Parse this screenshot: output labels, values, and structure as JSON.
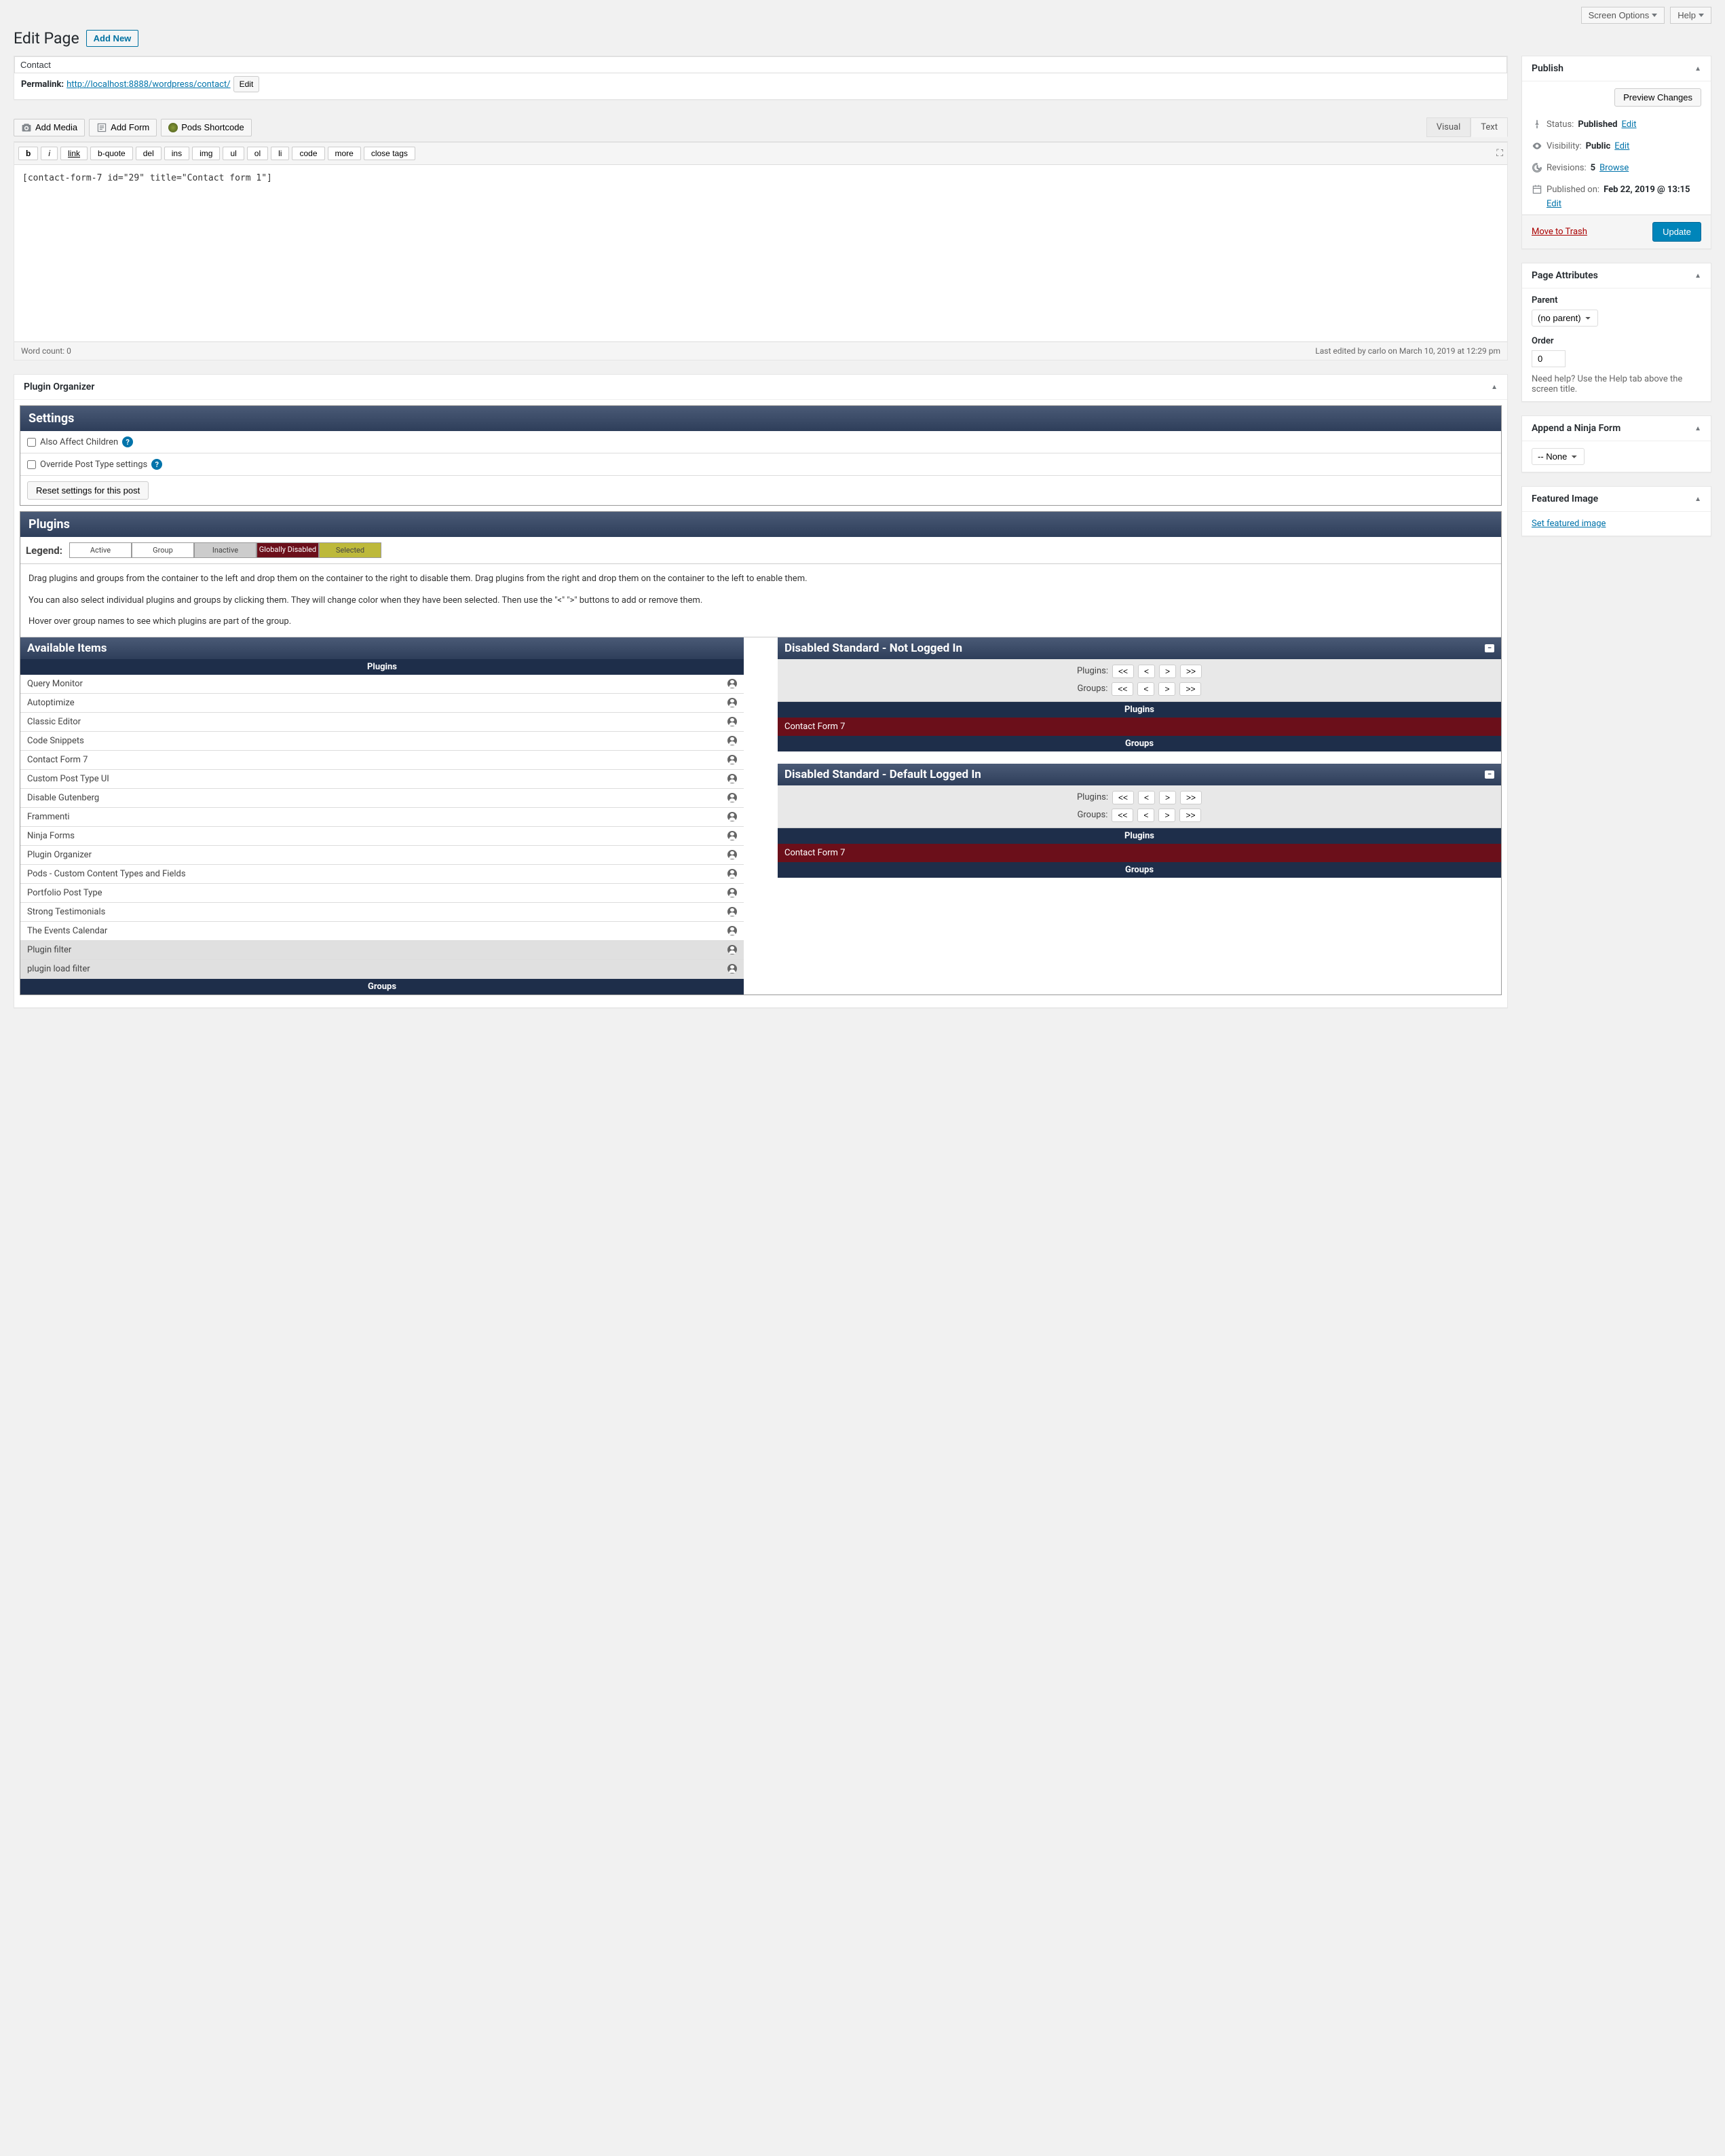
{
  "topbar": {
    "screen_options": "Screen Options",
    "help": "Help"
  },
  "header": {
    "title": "Edit Page",
    "add_new": "Add New"
  },
  "title_box": {
    "title": "Contact",
    "permalink_label": "Permalink:",
    "permalink_url": "http://localhost:8888/wordpress/contact/",
    "edit": "Edit"
  },
  "media_buttons": {
    "add_media": "Add Media",
    "add_form": "Add Form",
    "pods": "Pods Shortcode"
  },
  "editor_tabs": {
    "visual": "Visual",
    "text": "Text"
  },
  "quicktags": [
    "b",
    "i",
    "link",
    "b-quote",
    "del",
    "ins",
    "img",
    "ul",
    "ol",
    "li",
    "code",
    "more",
    "close tags"
  ],
  "editor_content": "[contact-form-7 id=\"29\" title=\"Contact form 1\"]",
  "editor_footer": {
    "word_count": "Word count: 0",
    "last_edited": "Last edited by carlo on March 10, 2019 at 12:29 pm"
  },
  "publish": {
    "title": "Publish",
    "preview": "Preview Changes",
    "status_label": "Status:",
    "status_value": "Published",
    "status_edit": "Edit",
    "visibility_label": "Visibility:",
    "visibility_value": "Public",
    "visibility_edit": "Edit",
    "revisions_label": "Revisions:",
    "revisions_value": "5",
    "revisions_browse": "Browse",
    "published_label": "Published on:",
    "published_value": "Feb 22, 2019 @ 13:15",
    "published_edit": "Edit",
    "trash": "Move to Trash",
    "update": "Update"
  },
  "page_attributes": {
    "title": "Page Attributes",
    "parent_label": "Parent",
    "parent_value": "(no parent)",
    "order_label": "Order",
    "order_value": "0",
    "help": "Need help? Use the Help tab above the screen title."
  },
  "ninja": {
    "title": "Append a Ninja Form",
    "value": "-- None"
  },
  "featured": {
    "title": "Featured Image",
    "link": "Set featured image"
  },
  "plugin_organizer": {
    "title": "Plugin Organizer",
    "settings": {
      "title": "Settings",
      "affect_children": "Also Affect Children",
      "override": "Override Post Type settings",
      "reset": "Reset settings for this post"
    },
    "plugins": {
      "title": "Plugins",
      "legend_label": "Legend:",
      "legend": {
        "active": "Active",
        "group": "Group",
        "inactive": "Inactive",
        "globally": "Globally Disabled",
        "selected": "Selected"
      },
      "desc1": "Drag plugins and groups from the container to the left and drop them on the container to the right to disable them. Drag plugins from the right and drop them on the container to the left to enable them.",
      "desc2": "You can also select individual plugins and groups by clicking them. They will change color when they have been selected. Then use the \"<\" \">\" buttons to add or remove them.",
      "desc3": "Hover over group names to see which plugins are part of the group.",
      "available_title": "Available Items",
      "plugins_header": "Plugins",
      "groups_header": "Groups",
      "available_list": [
        {
          "name": "Query Monitor",
          "inactive": false
        },
        {
          "name": "Autoptimize",
          "inactive": false
        },
        {
          "name": "Classic Editor",
          "inactive": false
        },
        {
          "name": "Code Snippets",
          "inactive": false
        },
        {
          "name": "Contact Form 7",
          "inactive": false
        },
        {
          "name": "Custom Post Type UI",
          "inactive": false
        },
        {
          "name": "Disable Gutenberg",
          "inactive": false
        },
        {
          "name": "Frammenti",
          "inactive": false
        },
        {
          "name": "Ninja Forms",
          "inactive": false
        },
        {
          "name": "Plugin Organizer",
          "inactive": false
        },
        {
          "name": "Pods - Custom Content Types and Fields",
          "inactive": false
        },
        {
          "name": "Portfolio Post Type",
          "inactive": false
        },
        {
          "name": "Strong Testimonials",
          "inactive": false
        },
        {
          "name": "The Events Calendar",
          "inactive": false
        },
        {
          "name": "Plugin filter",
          "inactive": true
        },
        {
          "name": "plugin load filter",
          "inactive": true
        }
      ],
      "disabled_not_logged": "Disabled Standard - Not Logged In",
      "disabled_logged": "Disabled Standard - Default Logged In",
      "plugins_label": "Plugins:",
      "groups_label": "Groups:",
      "nav": {
        "first": "<<",
        "prev": "<",
        "next": ">",
        "last": ">>"
      },
      "disabled_cf7": "Contact Form 7"
    }
  }
}
